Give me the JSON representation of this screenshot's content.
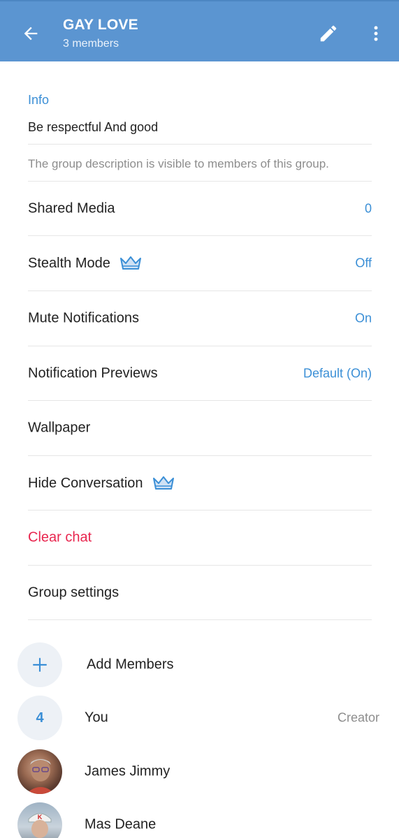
{
  "header": {
    "title": "GAY LOVE",
    "subtitle": "3 members",
    "back_icon": "arrow-left-icon",
    "edit_icon": "pencil-icon",
    "more_icon": "more-vertical-icon",
    "bg_color": "#5b95d1"
  },
  "info": {
    "label": "Info",
    "description": "Be respectful And good",
    "hint": "The group description is visible to members of this group."
  },
  "settings": {
    "shared_media": {
      "label": "Shared Media",
      "value": "0"
    },
    "stealth_mode": {
      "label": "Stealth Mode",
      "value": "Off",
      "icon": "crown-icon"
    },
    "mute_notifications": {
      "label": "Mute Notifications",
      "value": "On"
    },
    "notification_previews": {
      "label": "Notification Previews",
      "value": "Default (On)"
    },
    "wallpaper": {
      "label": "Wallpaper"
    },
    "hide_conversation": {
      "label": "Hide Conversation",
      "icon": "crown-icon"
    },
    "clear_chat": {
      "label": "Clear chat",
      "color": "#e8264f"
    },
    "group_settings": {
      "label": "Group settings"
    }
  },
  "members": {
    "add_label": "Add Members",
    "list": [
      {
        "avatar_text": "4",
        "name": "You",
        "role": "Creator"
      },
      {
        "name": "James  Jimmy"
      },
      {
        "name": "Mas Deane"
      }
    ]
  },
  "accent_color": "#3b8fd6"
}
